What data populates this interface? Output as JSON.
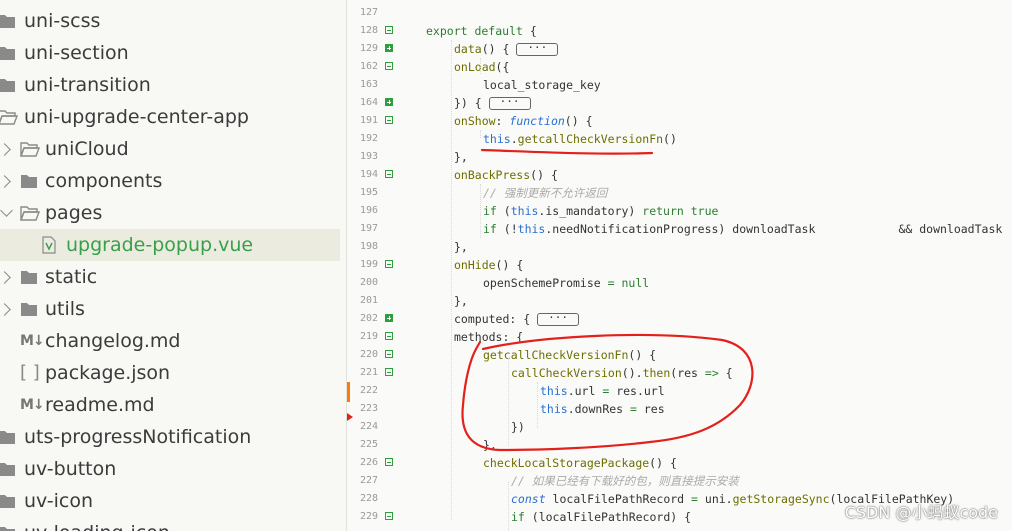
{
  "sidebar": {
    "items": [
      {
        "label": "uni-scss",
        "icon": "folder-icon",
        "indent": 0,
        "chevron": "none"
      },
      {
        "label": "uni-section",
        "icon": "folder-icon",
        "indent": 0,
        "chevron": "none"
      },
      {
        "label": "uni-transition",
        "icon": "folder-icon",
        "indent": 0,
        "chevron": "none"
      },
      {
        "label": "uni-upgrade-center-app",
        "icon": "folder-open-icon",
        "indent": 0,
        "chevron": "none"
      },
      {
        "label": "uniCloud",
        "icon": "cloud-folder-icon",
        "indent": 1,
        "chevron": "right"
      },
      {
        "label": "components",
        "icon": "folder-icon",
        "indent": 1,
        "chevron": "right"
      },
      {
        "label": "pages",
        "icon": "folder-open-icon",
        "indent": 1,
        "chevron": "down"
      },
      {
        "label": "upgrade-popup.vue",
        "icon": "vue-file-icon",
        "indent": 2,
        "chevron": "none",
        "selected": true
      },
      {
        "label": "static",
        "icon": "folder-icon",
        "indent": 1,
        "chevron": "right"
      },
      {
        "label": "utils",
        "icon": "folder-icon",
        "indent": 1,
        "chevron": "right"
      },
      {
        "label": "changelog.md",
        "icon": "markdown-file-icon",
        "indent": 1,
        "chevron": "none"
      },
      {
        "label": "package.json",
        "icon": "json-file-icon",
        "indent": 1,
        "chevron": "none"
      },
      {
        "label": "readme.md",
        "icon": "markdown-file-icon",
        "indent": 1,
        "chevron": "none"
      },
      {
        "label": "uts-progressNotification",
        "icon": "folder-icon",
        "indent": 0,
        "chevron": "none"
      },
      {
        "label": "uv-button",
        "icon": "folder-icon",
        "indent": 0,
        "chevron": "none"
      },
      {
        "label": "uv-icon",
        "icon": "folder-icon",
        "indent": 0,
        "chevron": "none"
      },
      {
        "label": "uv-loading-icon",
        "icon": "folder-icon",
        "indent": 0,
        "chevron": "none"
      }
    ],
    "md_icon_text": "M↓",
    "json_icon_text": "[ ]"
  },
  "editor": {
    "lines": [
      {
        "num": "127",
        "fold": "",
        "indent": 0,
        "tokens": []
      },
      {
        "num": "128",
        "fold": "minus",
        "indent": 1,
        "tokens": [
          [
            "kw",
            "export default"
          ],
          [
            "pl",
            " {"
          ]
        ]
      },
      {
        "num": "129",
        "fold": "plus",
        "indent": 2,
        "tokens": [
          [
            "fn",
            "data"
          ],
          [
            "pl",
            "() { "
          ],
          [
            "ellipsis",
            "···"
          ]
        ]
      },
      {
        "num": "162",
        "fold": "minus",
        "indent": 2,
        "tokens": [
          [
            "fn",
            "onLoad"
          ],
          [
            "pl",
            "({"
          ]
        ]
      },
      {
        "num": "163",
        "fold": "",
        "indent": 3,
        "tokens": [
          [
            "pl",
            "local_storage_key"
          ]
        ]
      },
      {
        "num": "164",
        "fold": "plus",
        "indent": 2,
        "tokens": [
          [
            "pl",
            "}) { "
          ],
          [
            "ellipsis",
            "···"
          ]
        ]
      },
      {
        "num": "191",
        "fold": "minus",
        "indent": 2,
        "tokens": [
          [
            "fn",
            "onShow"
          ],
          [
            "pl",
            ": "
          ],
          [
            "it",
            "function"
          ],
          [
            "pl",
            "() {"
          ]
        ]
      },
      {
        "num": "192",
        "fold": "",
        "indent": 3,
        "tokens": [
          [
            "this",
            "this"
          ],
          [
            "pl",
            "."
          ],
          [
            "fn",
            "getcallCheckVersionFn"
          ],
          [
            "pl",
            "()"
          ]
        ]
      },
      {
        "num": "193",
        "fold": "",
        "indent": 2,
        "tokens": [
          [
            "pl",
            "},"
          ]
        ]
      },
      {
        "num": "194",
        "fold": "minus",
        "indent": 2,
        "tokens": [
          [
            "fn",
            "onBackPress"
          ],
          [
            "pl",
            "() {"
          ]
        ]
      },
      {
        "num": "195",
        "fold": "",
        "indent": 3,
        "tokens": [
          [
            "cm",
            "// 强制更新不允许返回"
          ]
        ]
      },
      {
        "num": "196",
        "fold": "",
        "indent": 3,
        "tokens": [
          [
            "kw",
            "if"
          ],
          [
            "pl",
            " ("
          ],
          [
            "this",
            "this"
          ],
          [
            "pl",
            ".is_mandatory) "
          ],
          [
            "kw",
            "return true"
          ]
        ]
      },
      {
        "num": "197",
        "fold": "",
        "indent": 3,
        "tokens": [
          [
            "kw",
            "if"
          ],
          [
            "pl",
            " (!"
          ],
          [
            "this",
            "this"
          ],
          [
            "pl",
            ".needNotificationProgress) downloadTask            && downloadTask"
          ]
        ]
      },
      {
        "num": "198",
        "fold": "",
        "indent": 2,
        "tokens": [
          [
            "pl",
            "},"
          ]
        ]
      },
      {
        "num": "199",
        "fold": "minus",
        "indent": 2,
        "tokens": [
          [
            "fn",
            "onHide"
          ],
          [
            "pl",
            "() {"
          ]
        ]
      },
      {
        "num": "200",
        "fold": "",
        "indent": 3,
        "tokens": [
          [
            "pl",
            "openSchemePromise "
          ],
          [
            "kw",
            "="
          ],
          [
            "pl",
            " "
          ],
          [
            "kw",
            "null"
          ]
        ]
      },
      {
        "num": "201",
        "fold": "",
        "indent": 2,
        "tokens": [
          [
            "pl",
            "},"
          ]
        ]
      },
      {
        "num": "202",
        "fold": "plus",
        "indent": 2,
        "tokens": [
          [
            "pl",
            "computed: { "
          ],
          [
            "ellipsis",
            "···"
          ]
        ]
      },
      {
        "num": "219",
        "fold": "minus",
        "indent": 2,
        "tokens": [
          [
            "pl",
            "methods: {"
          ]
        ]
      },
      {
        "num": "220",
        "fold": "minus",
        "indent": 3,
        "tokens": [
          [
            "fn",
            "getcallCheckVersionFn"
          ],
          [
            "pl",
            "() {"
          ]
        ]
      },
      {
        "num": "221",
        "fold": "minus",
        "indent": 4,
        "tokens": [
          [
            "fn",
            "callCheckVersion"
          ],
          [
            "pl",
            "()."
          ],
          [
            "fn",
            "then"
          ],
          [
            "pl",
            "(res "
          ],
          [
            "kw",
            "=>"
          ],
          [
            "pl",
            " {"
          ]
        ]
      },
      {
        "num": "222",
        "fold": "",
        "indent": 5,
        "tokens": [
          [
            "this",
            "this"
          ],
          [
            "pl",
            ".url "
          ],
          [
            "kw",
            "="
          ],
          [
            "pl",
            " res.url"
          ]
        ]
      },
      {
        "num": "223",
        "fold": "",
        "indent": 5,
        "tokens": [
          [
            "this",
            "this"
          ],
          [
            "pl",
            ".downRes "
          ],
          [
            "kw",
            "="
          ],
          [
            "pl",
            " res"
          ]
        ]
      },
      {
        "num": "224",
        "fold": "",
        "indent": 4,
        "tokens": [
          [
            "pl",
            "})"
          ]
        ]
      },
      {
        "num": "225",
        "fold": "",
        "indent": 3,
        "tokens": [
          [
            "pl",
            "},"
          ]
        ]
      },
      {
        "num": "226",
        "fold": "minus",
        "indent": 3,
        "tokens": [
          [
            "fn",
            "checkLocalStoragePackage"
          ],
          [
            "pl",
            "() {"
          ]
        ]
      },
      {
        "num": "227",
        "fold": "",
        "indent": 4,
        "tokens": [
          [
            "cm",
            "// 如果已经有下载好的包，则直接提示安装"
          ]
        ]
      },
      {
        "num": "228",
        "fold": "",
        "indent": 4,
        "tokens": [
          [
            "it",
            "const"
          ],
          [
            "pl",
            " localFilePathRecord "
          ],
          [
            "kw",
            "="
          ],
          [
            "pl",
            " uni."
          ],
          [
            "fn",
            "getStorageSync"
          ],
          [
            "pl",
            "(localFilePathKey)"
          ]
        ]
      },
      {
        "num": "229",
        "fold": "minus",
        "indent": 4,
        "tokens": [
          [
            "kw",
            "if"
          ],
          [
            "pl",
            " (localFilePathRecord) {"
          ]
        ]
      }
    ]
  },
  "watermark": "CSDN @小蚂蚁code",
  "colors": {
    "annotation": "#e3201b",
    "marker": "#ff7b00"
  }
}
